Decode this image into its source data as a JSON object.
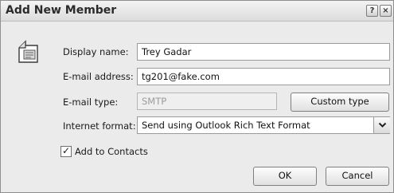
{
  "window": {
    "title": "Add New Member",
    "help_glyph": "?",
    "close_glyph": "×"
  },
  "form": {
    "display_name": {
      "label": "Display name:",
      "value": "Trey Gadar"
    },
    "email_address": {
      "label": "E-mail address:",
      "value": "tg201@fake.com"
    },
    "email_type": {
      "label": "E-mail type:",
      "value": "SMTP",
      "disabled": true
    },
    "custom_type_button": "Custom type",
    "internet_format": {
      "label": "Internet format:",
      "selected": "Send using Outlook Rich Text Format"
    },
    "add_to_contacts": {
      "label": "Add to Contacts",
      "checked": true,
      "check_glyph": "✓"
    }
  },
  "buttons": {
    "ok": "OK",
    "cancel": "Cancel"
  },
  "icons": {
    "contact": "contact-card-icon",
    "dropdown": "chevron-down-icon"
  }
}
